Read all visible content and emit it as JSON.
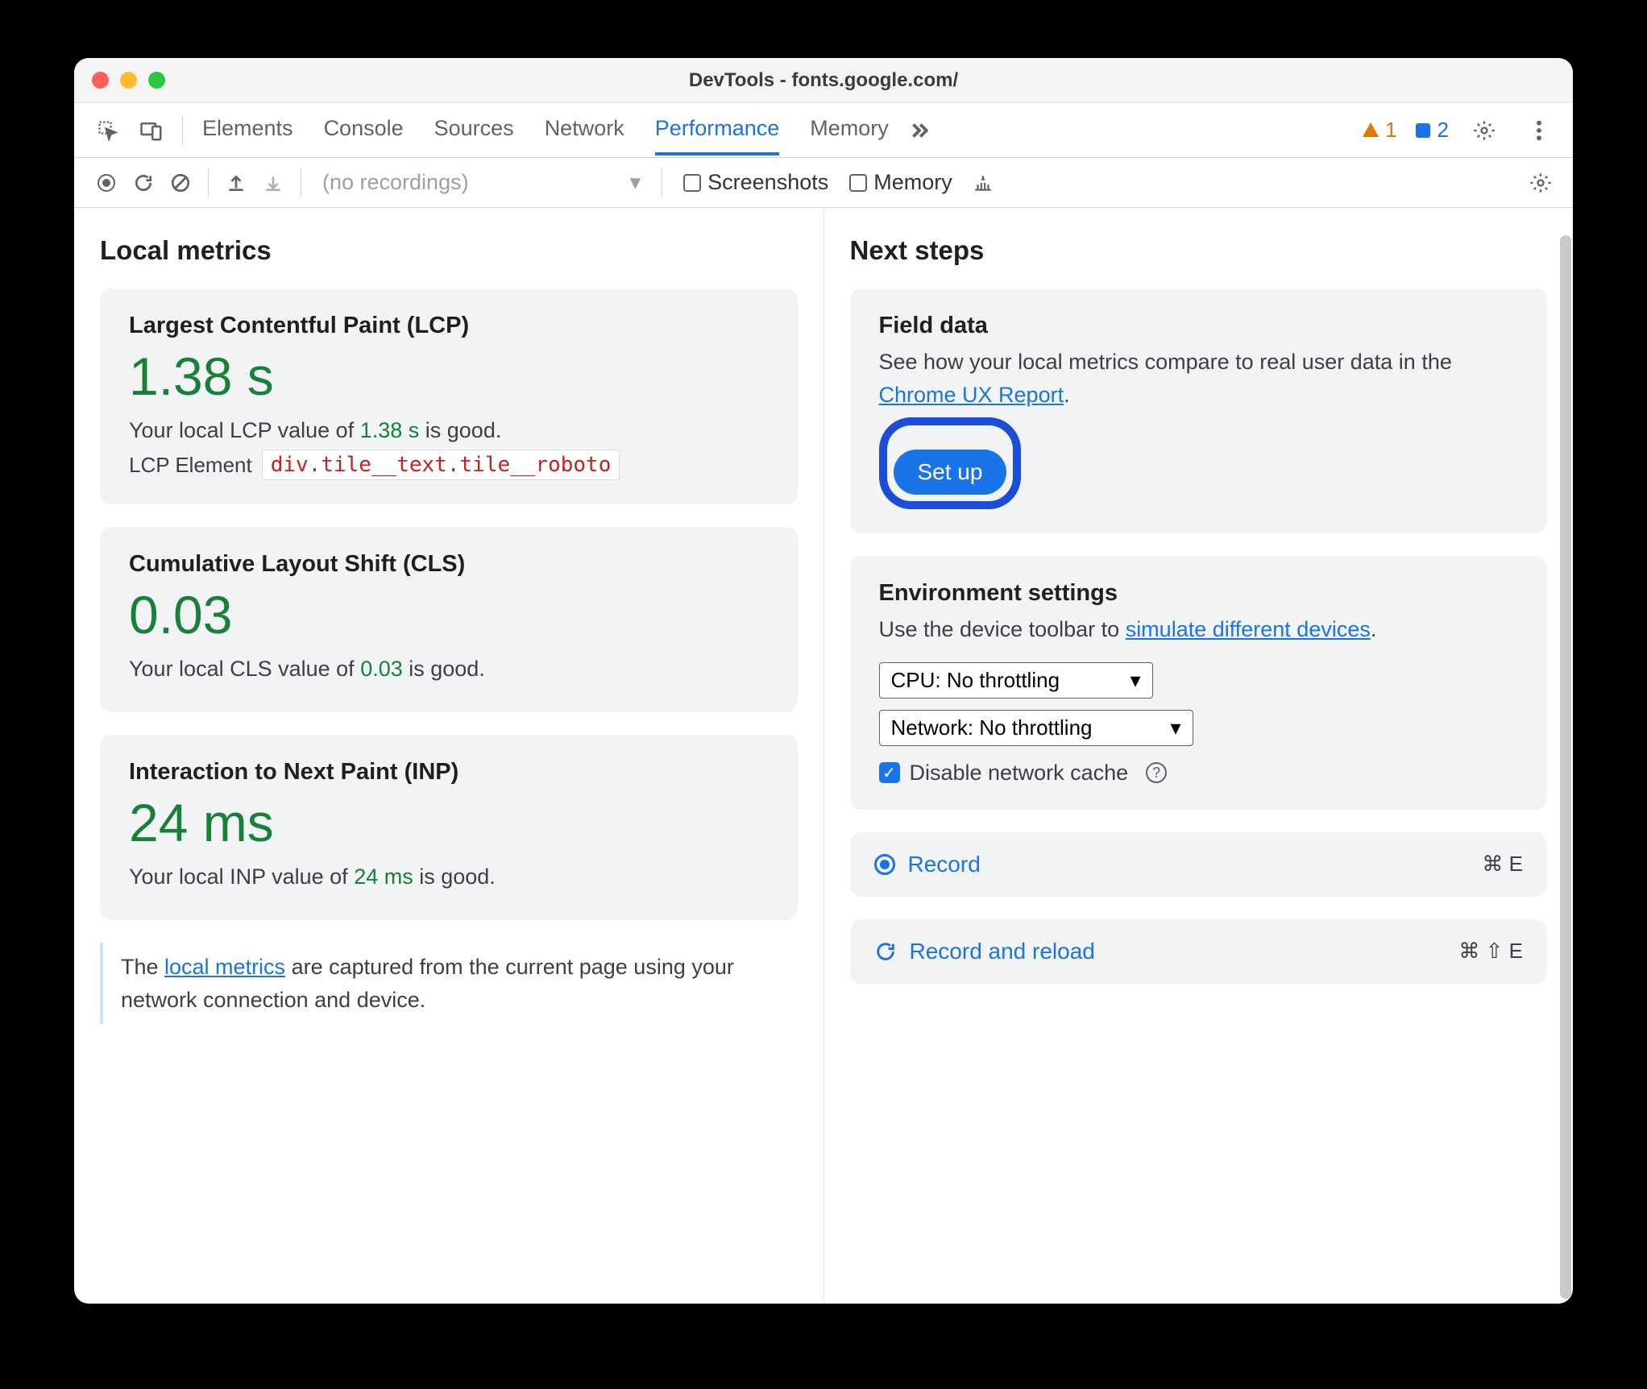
{
  "window": {
    "title": "DevTools - fonts.google.com/"
  },
  "tabs": [
    "Elements",
    "Console",
    "Sources",
    "Network",
    "Performance",
    "Memory"
  ],
  "active_tab": "Performance",
  "status": {
    "warnings": "1",
    "issues": "2"
  },
  "toolbar": {
    "recordings_dd": "(no recordings)",
    "screenshots": "Screenshots",
    "memory": "Memory"
  },
  "left": {
    "heading": "Local metrics",
    "lcp": {
      "title": "Largest Contentful Paint (LCP)",
      "value": "1.38 s",
      "note_prefix": "Your local LCP value of ",
      "note_val": "1.38 s",
      "note_suffix": " is good.",
      "el_label": "LCP Element",
      "el_sel": "div.tile__text.tile__roboto"
    },
    "cls": {
      "title": "Cumulative Layout Shift (CLS)",
      "value": "0.03",
      "note_prefix": "Your local CLS value of ",
      "note_val": "0.03",
      "note_suffix": " is good."
    },
    "inp": {
      "title": "Interaction to Next Paint (INP)",
      "value": "24 ms",
      "note_prefix": "Your local INP value of ",
      "note_val": "24 ms",
      "note_suffix": " is good."
    },
    "info_prefix": "The ",
    "info_link": "local metrics",
    "info_suffix": " are captured from the current page using your network connection and device."
  },
  "right": {
    "heading": "Next steps",
    "field": {
      "title": "Field data",
      "desc_prefix": "See how your local metrics compare to real user data in the ",
      "link": "Chrome UX Report",
      "desc_suffix": ".",
      "button": "Set up"
    },
    "env": {
      "title": "Environment settings",
      "desc_prefix": "Use the device toolbar to ",
      "link": "simulate different devices",
      "desc_suffix": ".",
      "cpu": "CPU: No throttling",
      "net": "Network: No throttling",
      "cache": "Disable network cache"
    },
    "record": {
      "label": "Record",
      "shortcut": "⌘ E"
    },
    "reload": {
      "label": "Record and reload",
      "shortcut": "⌘ ⇧ E"
    }
  }
}
